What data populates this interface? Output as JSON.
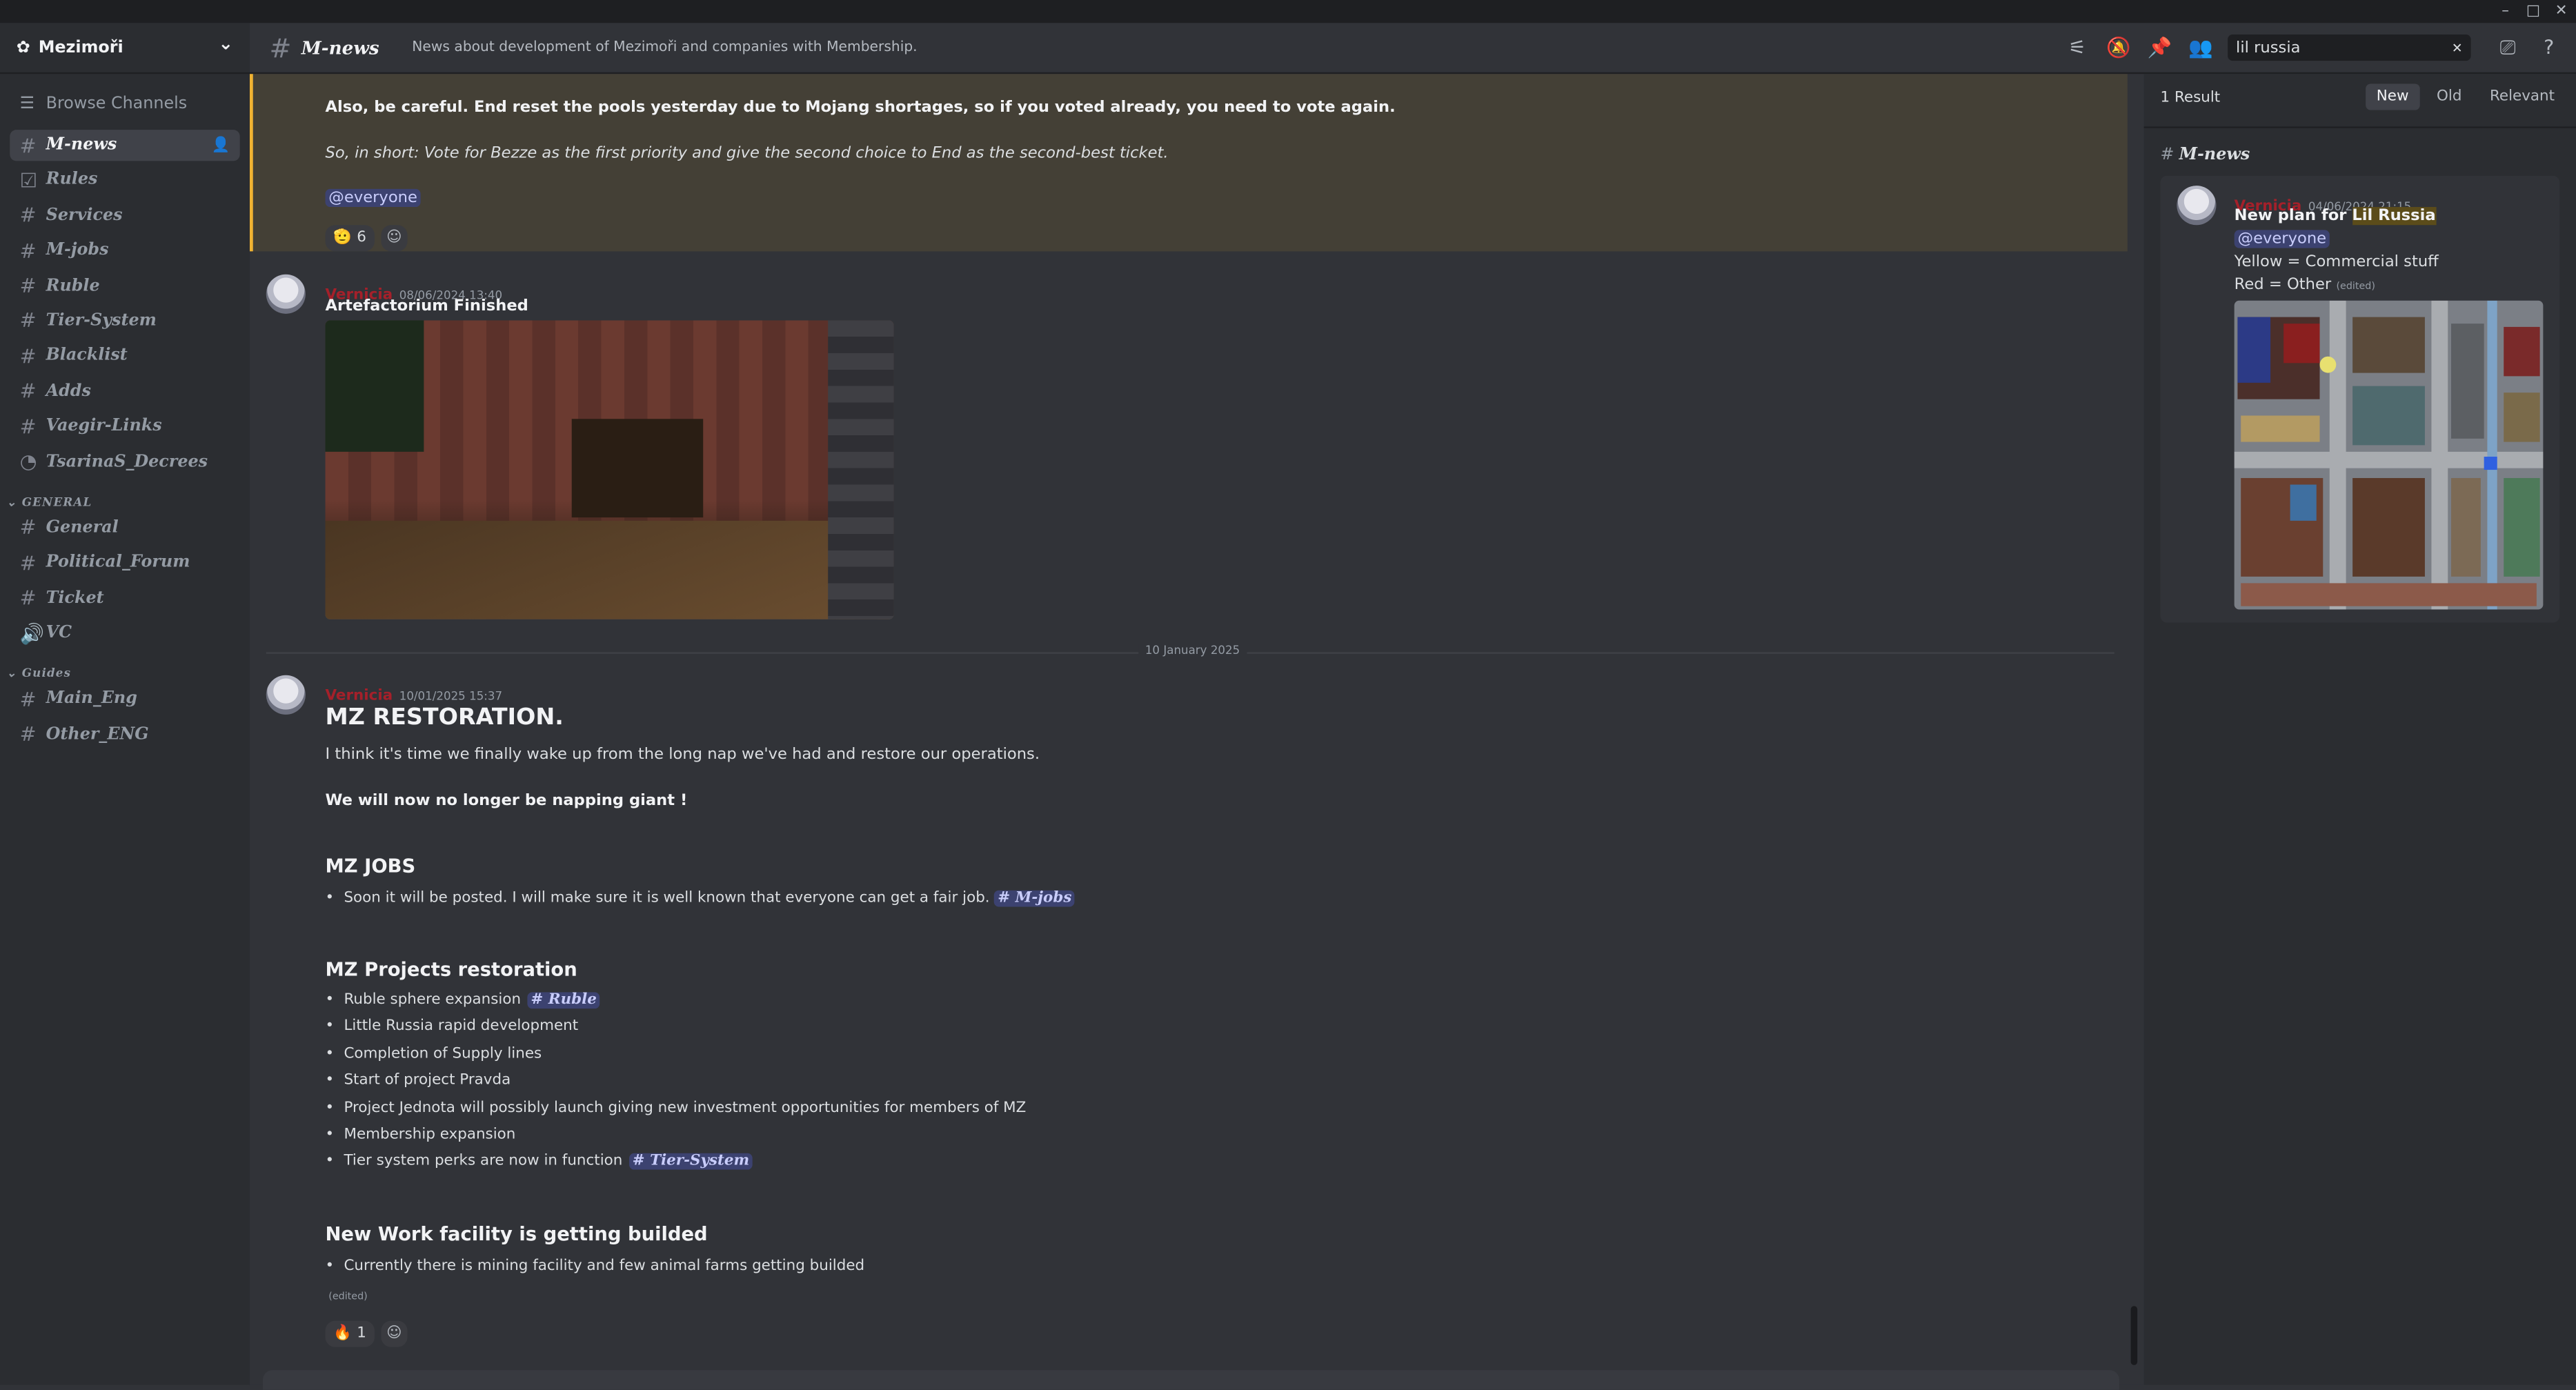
{
  "window": {
    "minimize": "–",
    "maximize": "□",
    "close": "✕"
  },
  "server": {
    "name": "Mezimoři",
    "icon": "server-icon",
    "chevron": "⌄"
  },
  "sidebar": {
    "browse_label": "Browse Channels",
    "channels_top": [
      {
        "name": "M-news",
        "icon": "#",
        "active": true
      },
      {
        "name": "Rules",
        "icon": "☑"
      },
      {
        "name": "Services",
        "icon": "#"
      },
      {
        "name": "M-jobs",
        "icon": "#"
      },
      {
        "name": "Ruble",
        "icon": "#"
      },
      {
        "name": "Tier-System",
        "icon": "#"
      },
      {
        "name": "Blacklist",
        "icon": "#"
      },
      {
        "name": "Adds",
        "icon": "#"
      },
      {
        "name": "Vaegir-Links",
        "icon": "#"
      },
      {
        "name": "TsarinaS_Decrees",
        "icon": "◔"
      }
    ],
    "category_general": "GENERAL",
    "channels_general": [
      {
        "name": "General",
        "icon": "#"
      },
      {
        "name": "Political_Forum",
        "icon": "#"
      },
      {
        "name": "Ticket",
        "icon": "#"
      },
      {
        "name": "VC",
        "icon": "🔊"
      }
    ],
    "category_guides": "Guides",
    "channels_guides": [
      {
        "name": "Main_Eng",
        "icon": "#"
      },
      {
        "name": "Other_ENG",
        "icon": "#"
      }
    ]
  },
  "header": {
    "channel": "M-news",
    "topic": "News about development of Mezimoři and companies with Membership.",
    "search_value": "lil russia",
    "search_clear": "✕"
  },
  "messages": {
    "m1_line1": "Also, be careful. End reset the pools yesterday due to Mojang shortages, so if you voted already, you need to vote again.",
    "m1_line2": "So, in short: Vote for Bezze as the first priority and give the second choice to End as the second-best ticket.",
    "m1_mention": "@everyone",
    "m1_reaction_emoji": "🫡",
    "m1_reaction_count": "6",
    "m2_author": "Vernicia",
    "m2_time": "08/06/2024 13:40",
    "m2_title": "Artefactorium Finished",
    "divider": "10 January 2025",
    "m3_author": "Vernicia",
    "m3_time": "10/01/2025 15:37",
    "m3_h1": "MZ RESTORATION.",
    "m3_p1": "I think it's time we finally wake up from the long nap we've had and restore our operations.",
    "m3_p2": "We will now no longer be napping giant !",
    "m3_h2a": "MZ JOBS",
    "m3_jobs_item": "Soon it will be posted. I will make sure it is well known that everyone can get a fair job.",
    "m3_jobs_mention": "# M-jobs",
    "m3_h2b": "MZ Projects restoration",
    "m3_projects": [
      "Ruble sphere expansion",
      "Little Russia rapid development",
      "Completion of Supply lines",
      "Start of project Pravda",
      "Project Jednota will possibly launch giving new investment opportunities for members of MZ",
      "Membership expansion",
      "Tier system perks are now in function"
    ],
    "m3_ruble_mention": "# Ruble",
    "m3_tier_mention": "# Tier-System",
    "m3_h2c": "New Work facility is getting builded",
    "m3_work_item": "Currently there is mining facility and few animal farms getting builded",
    "m3_edited": "(edited)",
    "m3_reaction_emoji": "🔥",
    "m3_reaction_count": "1"
  },
  "results": {
    "count": "1 Result",
    "tabs": [
      "New",
      "Old",
      "Relevant"
    ],
    "channel": "M-news",
    "author": "Vernicia",
    "time": "04/06/2024 21:15",
    "title_prefix": "New plan for ",
    "title_highlight": "Lil Russia",
    "mention": "@everyone",
    "line1": "Yellow = Commercial stuff",
    "line2": "Red = Other",
    "edited": "(edited)"
  },
  "colors": {
    "accent": "#5865f2",
    "author": "#a5202a",
    "highlight_border": "#f0b232"
  }
}
